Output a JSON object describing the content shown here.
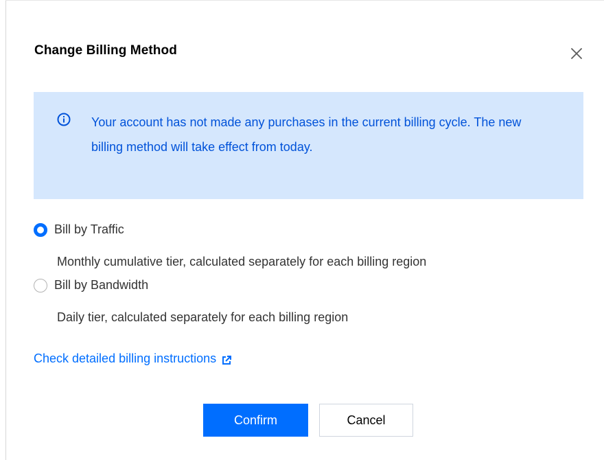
{
  "dialog": {
    "title": "Change Billing Method",
    "close_icon": "close-icon"
  },
  "notice": {
    "icon": "info-icon",
    "text": "Your account has not made any purchases in the current billing cycle. The new billing method will take effect from today.",
    "colors": {
      "background": "#d5e7fd",
      "text": "#0052d9"
    }
  },
  "options": [
    {
      "label": "Bill by Traffic",
      "description": "Monthly cumulative tier, calculated separately for each billing region",
      "selected": true
    },
    {
      "label": "Bill by Bandwidth",
      "description": "Daily tier, calculated separately for each billing region",
      "selected": false
    }
  ],
  "link": {
    "text": "Check detailed billing instructions",
    "icon": "external-link-icon"
  },
  "buttons": {
    "confirm_label": "Confirm",
    "cancel_label": "Cancel"
  },
  "colors": {
    "accent": "#006eff"
  }
}
